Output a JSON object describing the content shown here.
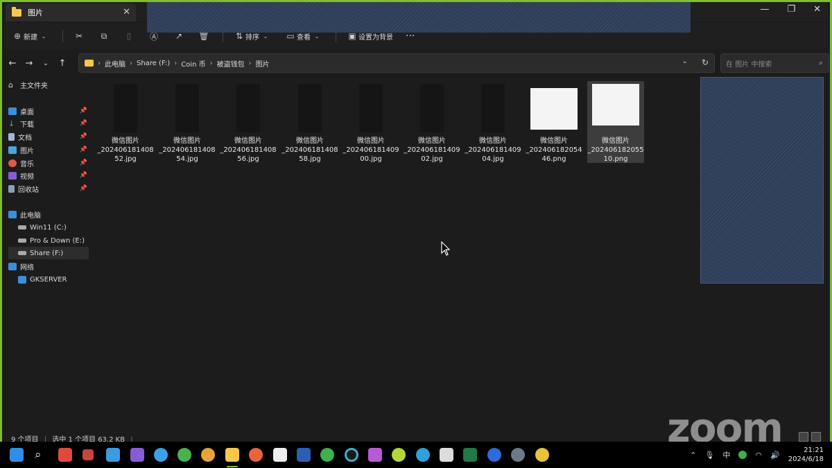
{
  "window": {
    "tab_title": "图片",
    "close": "✕",
    "controls": [
      "—",
      "❐",
      "✕"
    ]
  },
  "toolbar": {
    "new_label": "新建",
    "sort_label": "排序",
    "view_label": "查看",
    "set_bg_label": "设置为背景",
    "more": "···"
  },
  "address": {
    "crumbs": [
      "此电脑",
      "Share (F:)",
      "Coin 币",
      "被盗钱包",
      "图片"
    ],
    "search_placeholder": "在 图片 中搜索"
  },
  "sidebar": {
    "home": "主文件夹",
    "quick": [
      "桌面",
      "下载",
      "文档",
      "图片",
      "音乐",
      "视频",
      "回收站"
    ],
    "this_pc": "此电脑",
    "drives": [
      "Win11 (C:)",
      "Pro & Down (E:)",
      "Share (F:)"
    ],
    "network": "网络",
    "server": "GKSERVER"
  },
  "files": [
    {
      "line1": "微信图片",
      "line2": "_202406181408",
      "line3": "52.jpg",
      "kind": "dark"
    },
    {
      "line1": "微信图片",
      "line2": "_202406181408",
      "line3": "54.jpg",
      "kind": "dark"
    },
    {
      "line1": "微信图片",
      "line2": "_202406181408",
      "line3": "56.jpg",
      "kind": "dark"
    },
    {
      "line1": "微信图片",
      "line2": "_202406181408",
      "line3": "58.jpg",
      "kind": "dark"
    },
    {
      "line1": "微信图片",
      "line2": "_202406181409",
      "line3": "00.jpg",
      "kind": "dark"
    },
    {
      "line1": "微信图片",
      "line2": "_202406181409",
      "line3": "02.jpg",
      "kind": "dark"
    },
    {
      "line1": "微信图片",
      "line2": "_202406181409",
      "line3": "04.jpg",
      "kind": "dark"
    },
    {
      "line1": "微信图片",
      "line2": "_202406182054",
      "line3": "46.png",
      "kind": "light"
    },
    {
      "line1": "微信图片",
      "line2": "_202406182055",
      "line3": "10.png",
      "kind": "light",
      "selected": true
    }
  ],
  "status": {
    "count": "9 个项目",
    "selection": "选中 1 个项目  63.2 KB"
  },
  "watermark": "zoom",
  "taskbar": {
    "ime": "中",
    "time": "21:21",
    "date": "2024/6/18"
  },
  "colors": {
    "accent_border": "#7fbf2f",
    "folder": "#f5c84c",
    "background": "#1c1c1c"
  }
}
